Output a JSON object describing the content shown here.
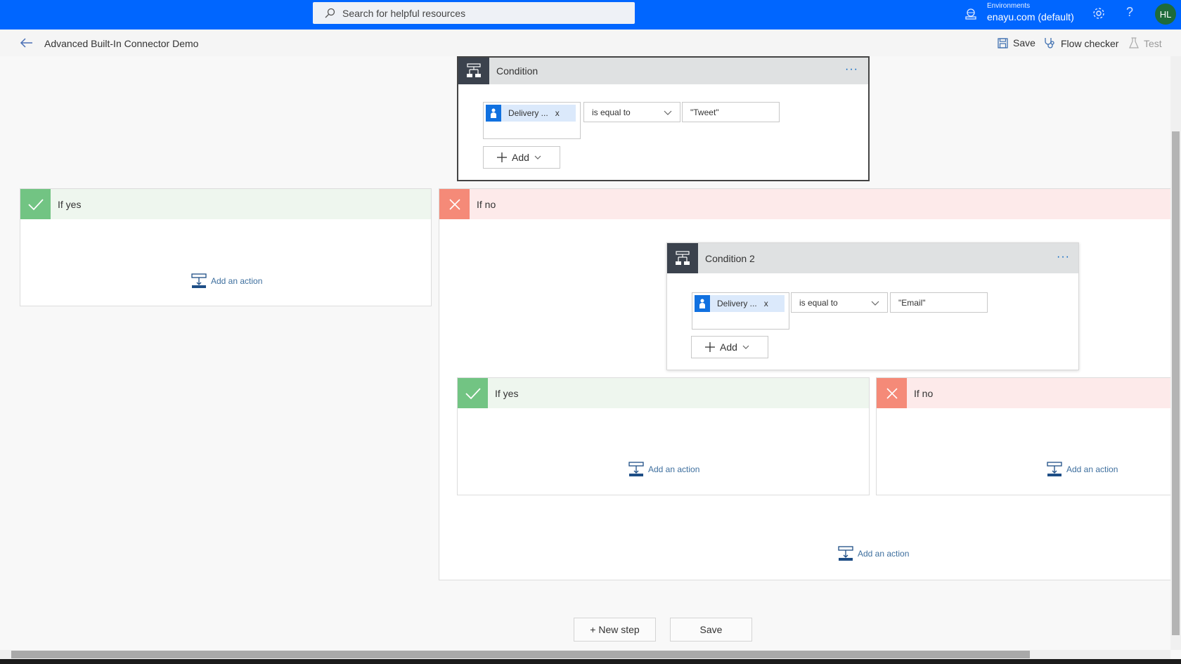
{
  "topbar": {
    "search_placeholder": "Search for helpful resources",
    "environment_label": "Environments",
    "environment_value": "enayu.com (default)",
    "help_label": "?",
    "avatar_initials": "HL",
    "brand_color": "#0066ff"
  },
  "commandbar": {
    "flow_title": "Advanced Built-In Connector Demo",
    "save_label": "Save",
    "flow_checker_label": "Flow checker",
    "test_label": "Test"
  },
  "condition1": {
    "title": "Condition",
    "more_label": "···",
    "token_label": "Delivery ...",
    "token_remove": "x",
    "operator": "is equal to",
    "value": "\"Tweet\"",
    "add_label": "Add"
  },
  "branch_yes_1": {
    "label": "If yes",
    "add_action_label": "Add an action"
  },
  "branch_no_1": {
    "label": "If no",
    "add_action_label": "Add an action"
  },
  "condition2": {
    "title": "Condition 2",
    "more_label": "···",
    "token_label": "Delivery ...",
    "token_remove": "x",
    "operator": "is equal to",
    "value": "\"Email\"",
    "add_label": "Add"
  },
  "branch_yes_2": {
    "label": "If yes",
    "add_action_label": "Add an action"
  },
  "branch_no_2": {
    "label": "If no",
    "add_action_label": "Add an action"
  },
  "footer": {
    "new_step_label": "+ New step",
    "save_label": "Save"
  },
  "colors": {
    "yes_accent": "#72c483",
    "no_accent": "#f58a78",
    "condition_icon_bg": "#3b424d",
    "token_icon_bg": "#1171e0"
  }
}
